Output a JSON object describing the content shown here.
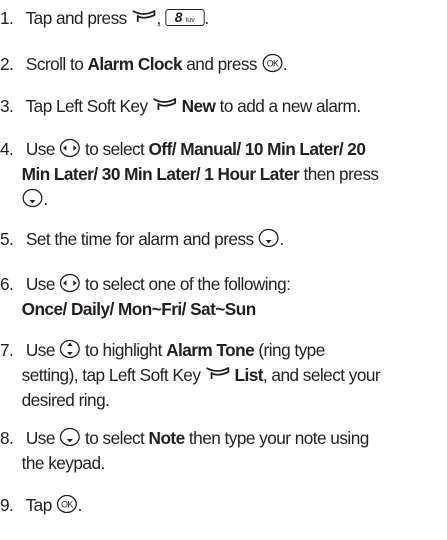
{
  "steps": [
    {
      "num": "1.",
      "t1": "Tap and press",
      "t2": ",",
      "key8": {
        "digit": "8",
        "letters": "tuv"
      },
      "t3": "."
    },
    {
      "num": "2.",
      "t1": "Scroll to",
      "b1": "Alarm Clock",
      "t2": "and press",
      "t3": "."
    },
    {
      "num": "3.",
      "t1": "Tap Left Soft Key",
      "b1": "New",
      "t2": "to add a new alarm."
    },
    {
      "num": "4.",
      "t1": "Use",
      "t2": "to select",
      "b1": "Off/ Manual/ 10 Min Later/ 20",
      "b2": "Min Later/ 30 Min Later/ 1 Hour Later",
      "t3": "then press",
      "t4": "."
    },
    {
      "num": "5.",
      "t1": "Set the time for alarm and press",
      "t2": "."
    },
    {
      "num": "6.",
      "t1": "Use",
      "t2": "to select one of the following:",
      "b1": "Once/ Daily/ Mon~Fri/ Sat~Sun"
    },
    {
      "num": "7.",
      "t1": "Use",
      "t2": "to highlight",
      "b1": "Alarm Tone",
      "t3": "(ring type",
      "t4": "setting), tap Left Soft Key",
      "b2": "List",
      "t5": ", and select your",
      "t6": "desired ring."
    },
    {
      "num": "8.",
      "t1": "Use",
      "t2": "to select",
      "b1": "Note",
      "t3": "then type your note using",
      "t4": "the keypad."
    },
    {
      "num": "9.",
      "t1": "Tap",
      "t2": "."
    }
  ],
  "icons": {
    "soft_key": "left-soft-key-icon",
    "ok_key": "ok-key-icon",
    "nav_lr": "nav-left-right-icon",
    "nav_ud": "nav-up-down-icon",
    "nav_down": "nav-down-icon"
  },
  "colors": {
    "text": "#231f20"
  }
}
